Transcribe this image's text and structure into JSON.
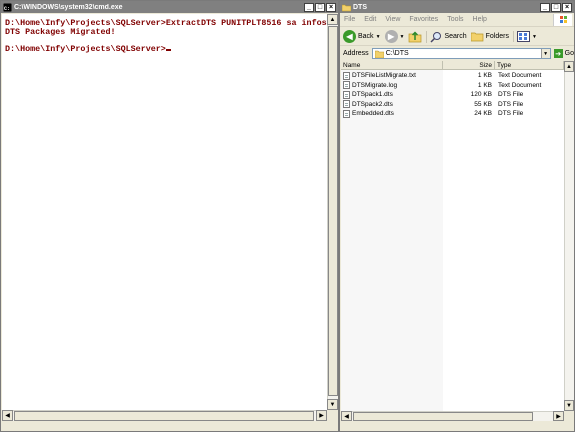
{
  "cmd": {
    "title": "C:\\WINDOWS\\system32\\cmd.exe",
    "lines": [
      "D:\\Home\\Infy\\Projects\\SQLServer>ExtractDTS PUNITPLT8516 sa infosys",
      "DTS Packages Migrated!",
      "",
      "D:\\Home\\Infy\\Projects\\SQLServer>"
    ],
    "text_color": "#800000"
  },
  "explorer": {
    "title": "DTS",
    "menu": [
      "File",
      "Edit",
      "View",
      "Favorites",
      "Tools",
      "Help"
    ],
    "toolbar": {
      "back": "Back",
      "search": "Search",
      "folders": "Folders"
    },
    "address": {
      "label": "Address",
      "value": "C:\\DTS",
      "go": "Go"
    },
    "columns": {
      "name": "Name",
      "size": "Size",
      "type": "Type"
    },
    "files": [
      {
        "name": "DTSFileListMigrate.txt",
        "size": "1 KB",
        "type": "Text Document"
      },
      {
        "name": "DTSMigrate.log",
        "size": "1 KB",
        "type": "Text Document"
      },
      {
        "name": "DTSpack1.dts",
        "size": "120 KB",
        "type": "DTS File"
      },
      {
        "name": "DTSpack2.dts",
        "size": "55 KB",
        "type": "DTS File"
      },
      {
        "name": "Embedded.dts",
        "size": "24 KB",
        "type": "DTS File"
      }
    ]
  },
  "window_buttons": {
    "minimize": "_",
    "maximize": "□",
    "close": "×"
  }
}
